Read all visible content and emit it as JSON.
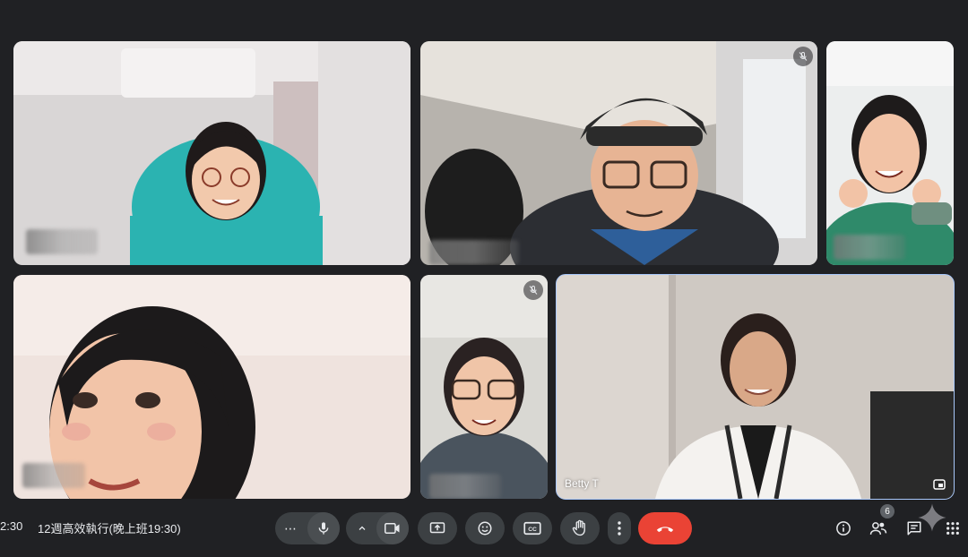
{
  "meeting": {
    "clock": "2:30",
    "title": "12週高效執行(晚上班19:30)"
  },
  "participants": [
    {
      "name": "",
      "muted": false
    },
    {
      "name": "",
      "muted": true
    },
    {
      "name": "",
      "muted": false
    },
    {
      "name": "",
      "muted": false
    },
    {
      "name": "",
      "muted": true
    },
    {
      "name": "Betty T",
      "muted": false,
      "active": true
    }
  ],
  "toolbar": {
    "more_options_glyph": "⋯",
    "participant_count": "6"
  },
  "icons": [
    "more-horiz-icon",
    "mic-icon",
    "chevron-up-icon",
    "camera-icon",
    "present-icon",
    "emoji-icon",
    "captions-icon",
    "raise-hand-icon",
    "more-vert-icon",
    "call-end-icon",
    "info-icon",
    "people-icon",
    "chat-icon",
    "sparkle-icon",
    "apps-icon",
    "mic-off-icon",
    "expand-icon"
  ],
  "colors": {
    "background": "#202124",
    "control": "#3c4043",
    "leave": "#ea4335",
    "active_outline": "#a8c7fa"
  }
}
